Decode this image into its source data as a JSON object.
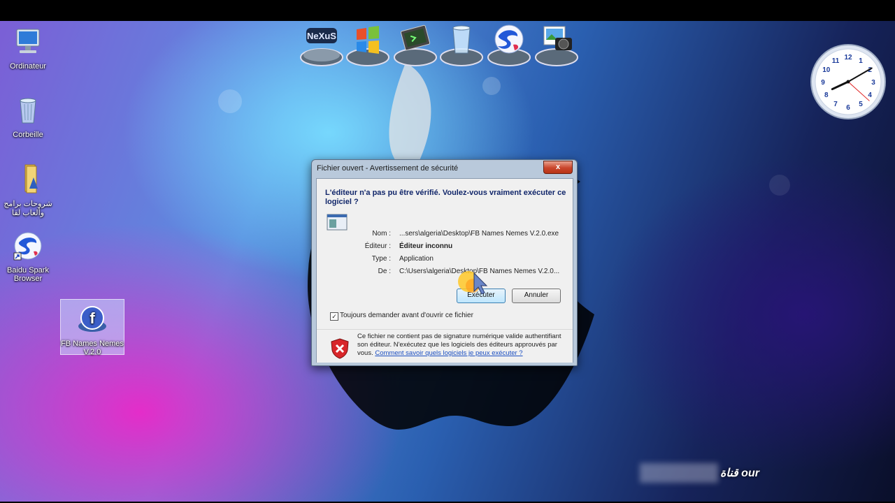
{
  "desktop": {
    "icons": [
      {
        "label": "Ordinateur",
        "icon": "computer-icon"
      },
      {
        "label": "Corbeille",
        "icon": "recycle-bin-icon"
      },
      {
        "label": "شروحات برامج وألعاب لقا",
        "icon": "folder-icon"
      },
      {
        "label": "Baidu Spark Browser",
        "icon": "baidu-spark-icon"
      },
      {
        "label": "FB Names Nemes V.2.0",
        "icon": "facebook-app-icon"
      }
    ]
  },
  "dock": {
    "items": [
      {
        "label": "NeXuS",
        "icon": "nexus-icon"
      },
      {
        "icon": "windows-logo-icon"
      },
      {
        "icon": "terminal-icon"
      },
      {
        "icon": "recycle-bin-icon"
      },
      {
        "icon": "baidu-spark-icon"
      },
      {
        "icon": "camera-photo-icon"
      }
    ]
  },
  "clock": {
    "numbers": [
      "12",
      "1",
      "2",
      "3",
      "4",
      "5",
      "6",
      "7",
      "8",
      "9",
      "10",
      "11"
    ],
    "time": {
      "hour": 8,
      "minute": 10,
      "second": 22
    }
  },
  "dialog": {
    "title": "Fichier ouvert - Avertissement de sécurité",
    "close_label": "x",
    "heading": "L'éditeur n'a pas pu être vérifié. Voulez-vous vraiment exécuter ce logiciel ?",
    "fields": [
      {
        "label": "Nom :",
        "value": "...sers\\algeria\\Desktop\\FB Names Nemes V.2.0.exe"
      },
      {
        "label": "Éditeur :",
        "value": "Éditeur inconnu"
      },
      {
        "label": "Type :",
        "value": "Application"
      },
      {
        "label": "De :",
        "value": "C:\\Users\\algeria\\Desktop\\FB Names Nemes V.2.0..."
      }
    ],
    "run_button": "Exécuter",
    "cancel_button": "Annuler",
    "checkbox_label": "Toujours demander avant d'ouvrir ce fichier",
    "checkbox_checked": true,
    "warning_text": "Ce fichier ne contient pas de signature numérique valide authentifiant son éditeur. N'exécutez que les logiciels des éditeurs approuvés par vous.",
    "warning_link": "Comment savoir quels logiciels je peux exécuter ?"
  },
  "watermark": {
    "text": "قناة our"
  },
  "colors": {
    "dialog_frame": "#b9c9db",
    "heading_text": "#11266a",
    "link": "#1c4fc1",
    "close_button": "#c9462c"
  }
}
